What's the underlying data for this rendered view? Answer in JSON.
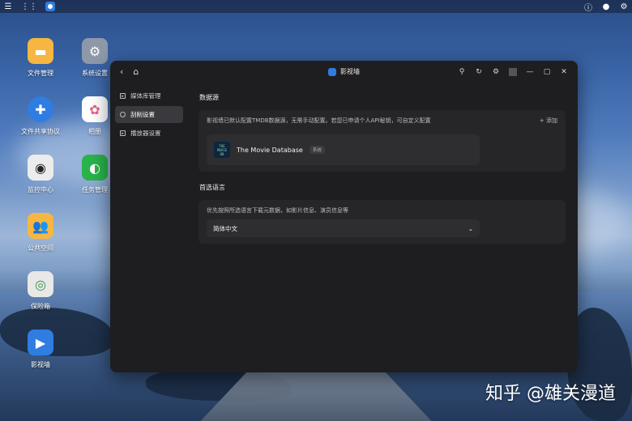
{
  "taskbar": {
    "left_icons": [
      "menu-icon",
      "app-grid-icon"
    ],
    "active_app_icon": "video-wall-icon",
    "right_icons": [
      "info-icon",
      "user-icon",
      "settings-icon"
    ]
  },
  "desktop": {
    "icons": [
      {
        "label": "文件管理",
        "icon": "folder-icon",
        "color": "#f5b642"
      },
      {
        "label": "系统设置",
        "icon": "gear-icon",
        "color": "#8d98a8"
      },
      {
        "label": "文件共享协议",
        "icon": "share-icon",
        "color": "#2f7de1"
      },
      {
        "label": "相册",
        "icon": "photos-icon",
        "color": "#ffffff"
      },
      {
        "label": "监控中心",
        "icon": "camera-icon",
        "color": "#ececec"
      },
      {
        "label": "任务管理",
        "icon": "task-icon",
        "color": "#29b34b"
      },
      {
        "label": "公共空间",
        "icon": "public-folder-icon",
        "color": "#f5b642"
      },
      {
        "label": "保险箱",
        "icon": "safe-icon",
        "color": "#e8e8e8"
      },
      {
        "label": "影视墙",
        "icon": "video-wall-icon",
        "color": "#2f7de1"
      }
    ]
  },
  "window": {
    "title": "影视墙",
    "sidebar": [
      {
        "label": "媒体库管理",
        "icon": "library-icon",
        "active": false
      },
      {
        "label": "刮削设置",
        "icon": "scrape-settings-icon",
        "active": true
      },
      {
        "label": "播放器设置",
        "icon": "player-icon",
        "active": false
      }
    ],
    "data_source": {
      "title": "数据源",
      "description": "影视墙已默认配置TMDB数据源，无需手动配置。若您已申请个人API秘钥，可自定义配置",
      "add_label": "+ 添加",
      "source": {
        "logo_text": [
          "THE",
          "MOVIE",
          "DB"
        ],
        "name": "The Movie Database",
        "badge": "系统"
      }
    },
    "language": {
      "title": "首选语言",
      "description": "优先按照所选语言下载元数据，如影片信息、演员信息等",
      "selected": "简体中文"
    }
  },
  "watermark": "知乎 @雄关漫道"
}
